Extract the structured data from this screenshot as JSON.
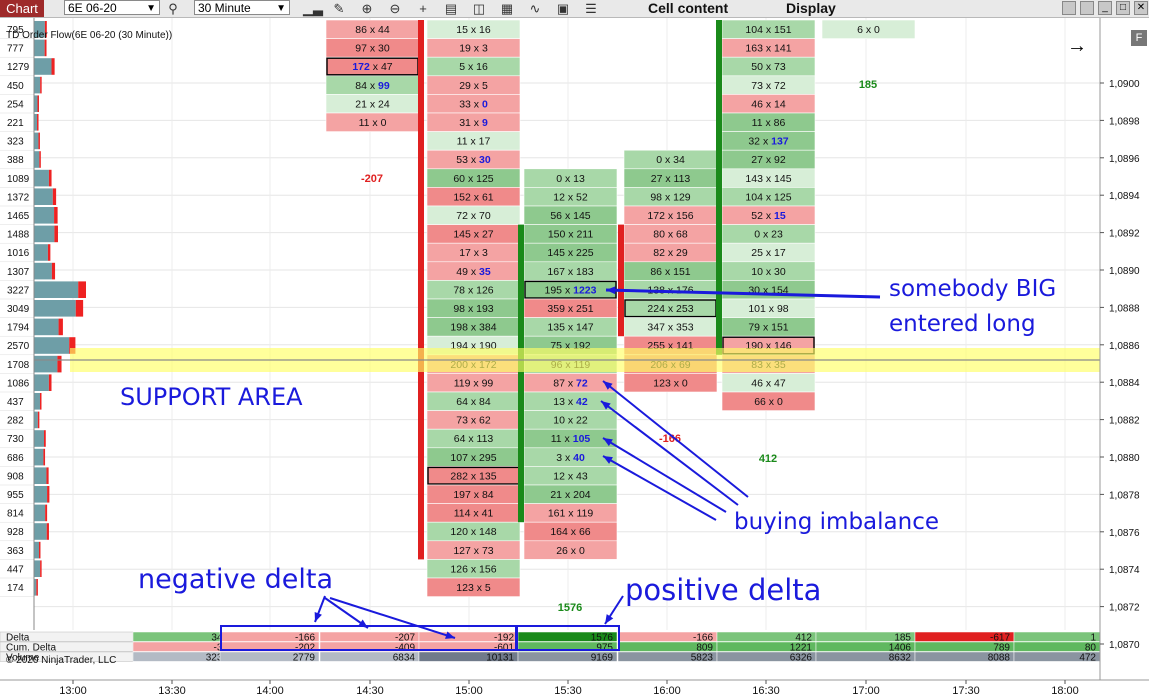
{
  "toolbar": {
    "chart_tab": "Chart",
    "instrument": "6E 06-20",
    "timeframe": "30 Minute",
    "menu_cell_content": "Cell content",
    "menu_display": "Display"
  },
  "indicator_label": "TD Order Flow(6E 06-20 (30 Minute))",
  "copyright": "© 2020 NinjaTrader, LLC",
  "colors": {
    "bid_dominant": "#f4a3a3",
    "ask_dominant": "#a8d8a8",
    "neutral_light": "#d7eed7",
    "delta_pos": "#1a8a1a",
    "delta_neg": "#e02020",
    "annotation": "#1a1adc",
    "support_band": "#ffff66"
  },
  "annotations": {
    "big_long_line1": "somebody BIG",
    "big_long_line2": "entered long",
    "support": "SUPPORT AREA",
    "buying_imbalance": "buying imbalance",
    "negative_delta": "negative delta",
    "positive_delta": "positive delta"
  },
  "chart_data": {
    "type": "table",
    "price_axis": {
      "min": 1.087,
      "max": 1.0901,
      "ticks": [
        "1,0900",
        "1,0898",
        "1,0896",
        "1,0894",
        "1,0892",
        "1,0890",
        "1,0888",
        "1,0886",
        "1,0884",
        "1,0882",
        "1,0880",
        "1,0878",
        "1,0876",
        "1,0874",
        "1,0872",
        "1,0870"
      ]
    },
    "time_axis": {
      "ticks": [
        "13:00",
        "13:30",
        "14:00",
        "14:30",
        "15:00",
        "15:30",
        "16:00",
        "16:30",
        "17:00",
        "17:30",
        "18:00"
      ]
    },
    "volume_profile": [
      {
        "price": "1,0902",
        "vol": "795"
      },
      {
        "price": "1,0901",
        "vol": "777"
      },
      {
        "price": "1,0900",
        "vol": "1279"
      },
      {
        "price": "1,08995",
        "vol": "450"
      },
      {
        "price": "1,0899",
        "vol": "254"
      },
      {
        "price": "1,08985",
        "vol": "221"
      },
      {
        "price": "1,0898",
        "vol": "323"
      },
      {
        "price": "1,08975",
        "vol": "388"
      },
      {
        "price": "1,0897",
        "vol": "1089"
      },
      {
        "price": "1,08965",
        "vol": "1372"
      },
      {
        "price": "1,0896",
        "vol": "1465"
      },
      {
        "price": "1,08955",
        "vol": "1488"
      },
      {
        "price": "1,0895",
        "vol": "1016"
      },
      {
        "price": "1,08945",
        "vol": "1307"
      },
      {
        "price": "1,0894",
        "vol": "3227"
      },
      {
        "price": "1,08935",
        "vol": "3049"
      },
      {
        "price": "1,0893",
        "vol": "1794"
      },
      {
        "price": "1,08925",
        "vol": "2570"
      },
      {
        "price": "1,0892",
        "vol": "1708"
      },
      {
        "price": "1,08915",
        "vol": "1086"
      },
      {
        "price": "1,0891",
        "vol": "437"
      },
      {
        "price": "1,08905",
        "vol": "282"
      },
      {
        "price": "1,0890",
        "vol": "730"
      },
      {
        "price": "1,08895",
        "vol": "686"
      },
      {
        "price": "1,0889",
        "vol": "908"
      },
      {
        "price": "1,08885",
        "vol": "955"
      },
      {
        "price": "1,0888",
        "vol": "814"
      },
      {
        "price": "1,08875",
        "vol": "928"
      },
      {
        "price": "1,0887",
        "vol": "363"
      },
      {
        "price": "1,08865",
        "vol": "447"
      },
      {
        "price": "1,0886",
        "vol": "174"
      }
    ],
    "bars": [
      {
        "name": "14:30",
        "rowStart": 0,
        "cells": [
          "86 x 44",
          "97 x 30",
          "172 x 47",
          "84 x 99",
          "21 x 24",
          "11 x 0"
        ],
        "delta_label": "-207"
      },
      {
        "name": "15:00",
        "rowStart": 0,
        "cells": [
          "15 x 16",
          "19 x 3",
          "5 x 16",
          "29 x 5",
          "33 x 0",
          "31 x 9",
          "11 x 17",
          "53 x 30",
          "60 x 125",
          "152 x 61",
          "72 x 70",
          "145 x 27",
          "17 x 3",
          "49 x 35",
          "78 x 126",
          "98 x 193",
          "198 x 384",
          "194 x 190",
          "200 x 172",
          "119 x 99",
          "64 x 84",
          "73 x 62",
          "64 x 113",
          "107 x 295",
          "282 x 135",
          "197 x 84",
          "114 x 41",
          "120 x 148",
          "127 x 73",
          "126 x 156",
          "123 x 5"
        ]
      },
      {
        "name": "15:30",
        "rowStart": 8,
        "cells": [
          "0 x 13",
          "12 x 52",
          "56 x 145",
          "150 x 211",
          "145 x 225",
          "167 x 183",
          "195 x 1223",
          "359 x 251",
          "135 x 147",
          "75 x 192",
          "96 x 119",
          "87 x 72",
          "13 x 42",
          "10 x 22",
          "11 x 105",
          "3 x 40",
          "12 x 43",
          "21 x 204",
          "161 x 119",
          "164 x 66",
          "26 x 0"
        ],
        "delta_label": "1576"
      },
      {
        "name": "16:00",
        "rowStart": 7,
        "cells": [
          "0 x 34",
          "27 x 113",
          "98 x 129",
          "172 x 156",
          "80 x 68",
          "82 x 29",
          "86 x 151",
          "138 x 176",
          "224 x 253",
          "347 x 353",
          "255 x 141",
          "206 x 69",
          "123 x 0"
        ],
        "delta_label": "-166"
      },
      {
        "name": "16:30",
        "rowStart": 0,
        "cells": [
          "104 x 151",
          "163 x 141",
          "50 x 73",
          "73 x 72",
          "46 x 14",
          "11 x 86",
          "32 x 137",
          "27 x 92",
          "143 x 145",
          "104 x 125",
          "52 x 15",
          "0 x 23",
          "25 x 17",
          "10 x 30",
          "30 x 154",
          "101 x 98",
          "79 x 151",
          "190 x 146",
          "83 x 35",
          "46 x 47",
          "66 x 0"
        ],
        "delta_label": "412"
      },
      {
        "name": "17:00",
        "rowStart": 0,
        "cells": [
          "6 x 0"
        ],
        "delta_label": "185"
      }
    ],
    "delta_rows": {
      "labels": [
        "Delta",
        "Cum. Delta",
        "Volume"
      ],
      "delta": [
        "344",
        "-166",
        "-207",
        "-192",
        "1576",
        "-166",
        "412",
        "185",
        "-617",
        "1"
      ],
      "cum_delta": [
        "-36",
        "-202",
        "-409",
        "-601",
        "975",
        "809",
        "1221",
        "1406",
        "789",
        "80"
      ],
      "volume": [
        "3230",
        "2779",
        "6834",
        "10131",
        "9169",
        "5823",
        "6326",
        "8632",
        "8088",
        "472"
      ]
    }
  }
}
